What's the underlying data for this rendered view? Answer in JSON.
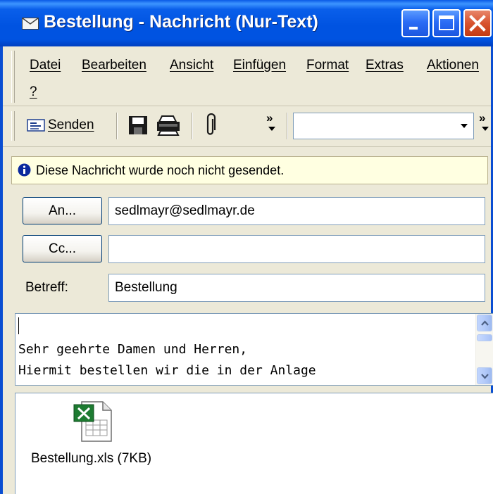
{
  "window": {
    "title": "Bestellung - Nachricht (Nur-Text)",
    "icon": "envelope-icon"
  },
  "menu": {
    "items": [
      {
        "label": "Datei"
      },
      {
        "label": "Bearbeiten"
      },
      {
        "label": "Ansicht"
      },
      {
        "label": "Einfügen"
      },
      {
        "label": "Format"
      },
      {
        "label": "Extras"
      },
      {
        "label": "Aktionen"
      },
      {
        "label": "?"
      }
    ]
  },
  "toolbar": {
    "send_label": "Senden",
    "overflow_label": "»"
  },
  "infobar": {
    "text": "Diese Nachricht wurde noch nicht gesendet."
  },
  "header": {
    "to_button": "An...",
    "to_value": "sedlmayr@sedlmayr.de",
    "cc_button": "Cc...",
    "cc_value": "",
    "subject_label": "Betreff:",
    "subject_value": "Bestellung"
  },
  "body": {
    "line1": "Sehr geehrte Damen und Herren,",
    "line2": "Hiermit bestellen wir die in der Anlage"
  },
  "attachment": {
    "name": "Bestellung.xls (7KB)",
    "icon": "excel-file-icon"
  },
  "colors": {
    "titlebar": "#0053E1",
    "close_button": "#D8532F",
    "infobar_bg": "#FFFFE1"
  }
}
